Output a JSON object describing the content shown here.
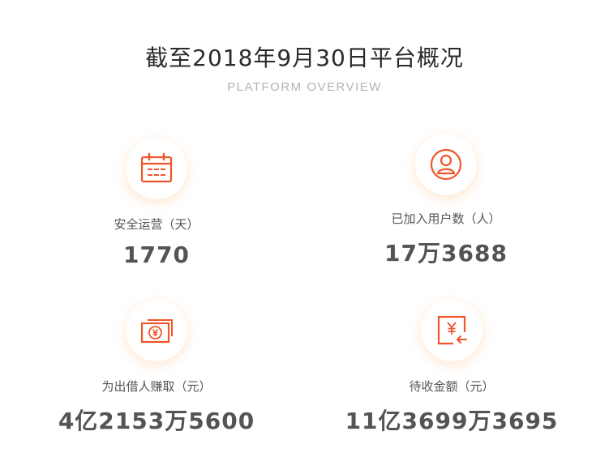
{
  "header": {
    "title": "截至2018年9月30日平台概况",
    "subtitle": "PLATFORM OVERVIEW"
  },
  "accent_color": "#f0552b",
  "stats": [
    {
      "icon": "calendar-icon",
      "label": "安全运营（天）",
      "value": "1770"
    },
    {
      "icon": "user-icon",
      "label": "已加入用户数（人）",
      "value": "17万3688"
    },
    {
      "icon": "yuan-banknote-icon",
      "label": "为出借人赚取（元）",
      "value": "4亿2153万5600"
    },
    {
      "icon": "yuan-transfer-icon",
      "label": "待收金额（元）",
      "value": "11亿3699万3695"
    }
  ]
}
